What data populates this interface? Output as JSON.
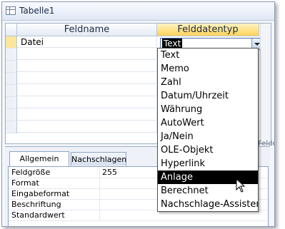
{
  "window": {
    "title": "Tabelle1"
  },
  "grid": {
    "columns": [
      "Feldname",
      "Felddatentyp"
    ],
    "rows": [
      {
        "name": "Datei",
        "type": "Text"
      }
    ]
  },
  "dropdown": {
    "items": [
      "Text",
      "Memo",
      "Zahl",
      "Datum/Uhrzeit",
      "Währung",
      "AutoWert",
      "Ja/Nein",
      "OLE-Objekt",
      "Hyperlink",
      "Anlage",
      "Berechnet",
      "Nachschlage-Assistent..."
    ],
    "selected": "Anlage"
  },
  "fieldproperties_partial_label": "Felde",
  "tabs": [
    "Allgemein",
    "Nachschlagen"
  ],
  "properties": [
    {
      "name": "Feldgröße",
      "value": "255"
    },
    {
      "name": "Format",
      "value": ""
    },
    {
      "name": "Eingabeformat",
      "value": ""
    },
    {
      "name": "Beschriftung",
      "value": ""
    },
    {
      "name": "Standardwert",
      "value": ""
    }
  ],
  "colors": {
    "active_header": "#ffd35a",
    "selection": "#000000",
    "frame_border": "#8c9cb4"
  }
}
